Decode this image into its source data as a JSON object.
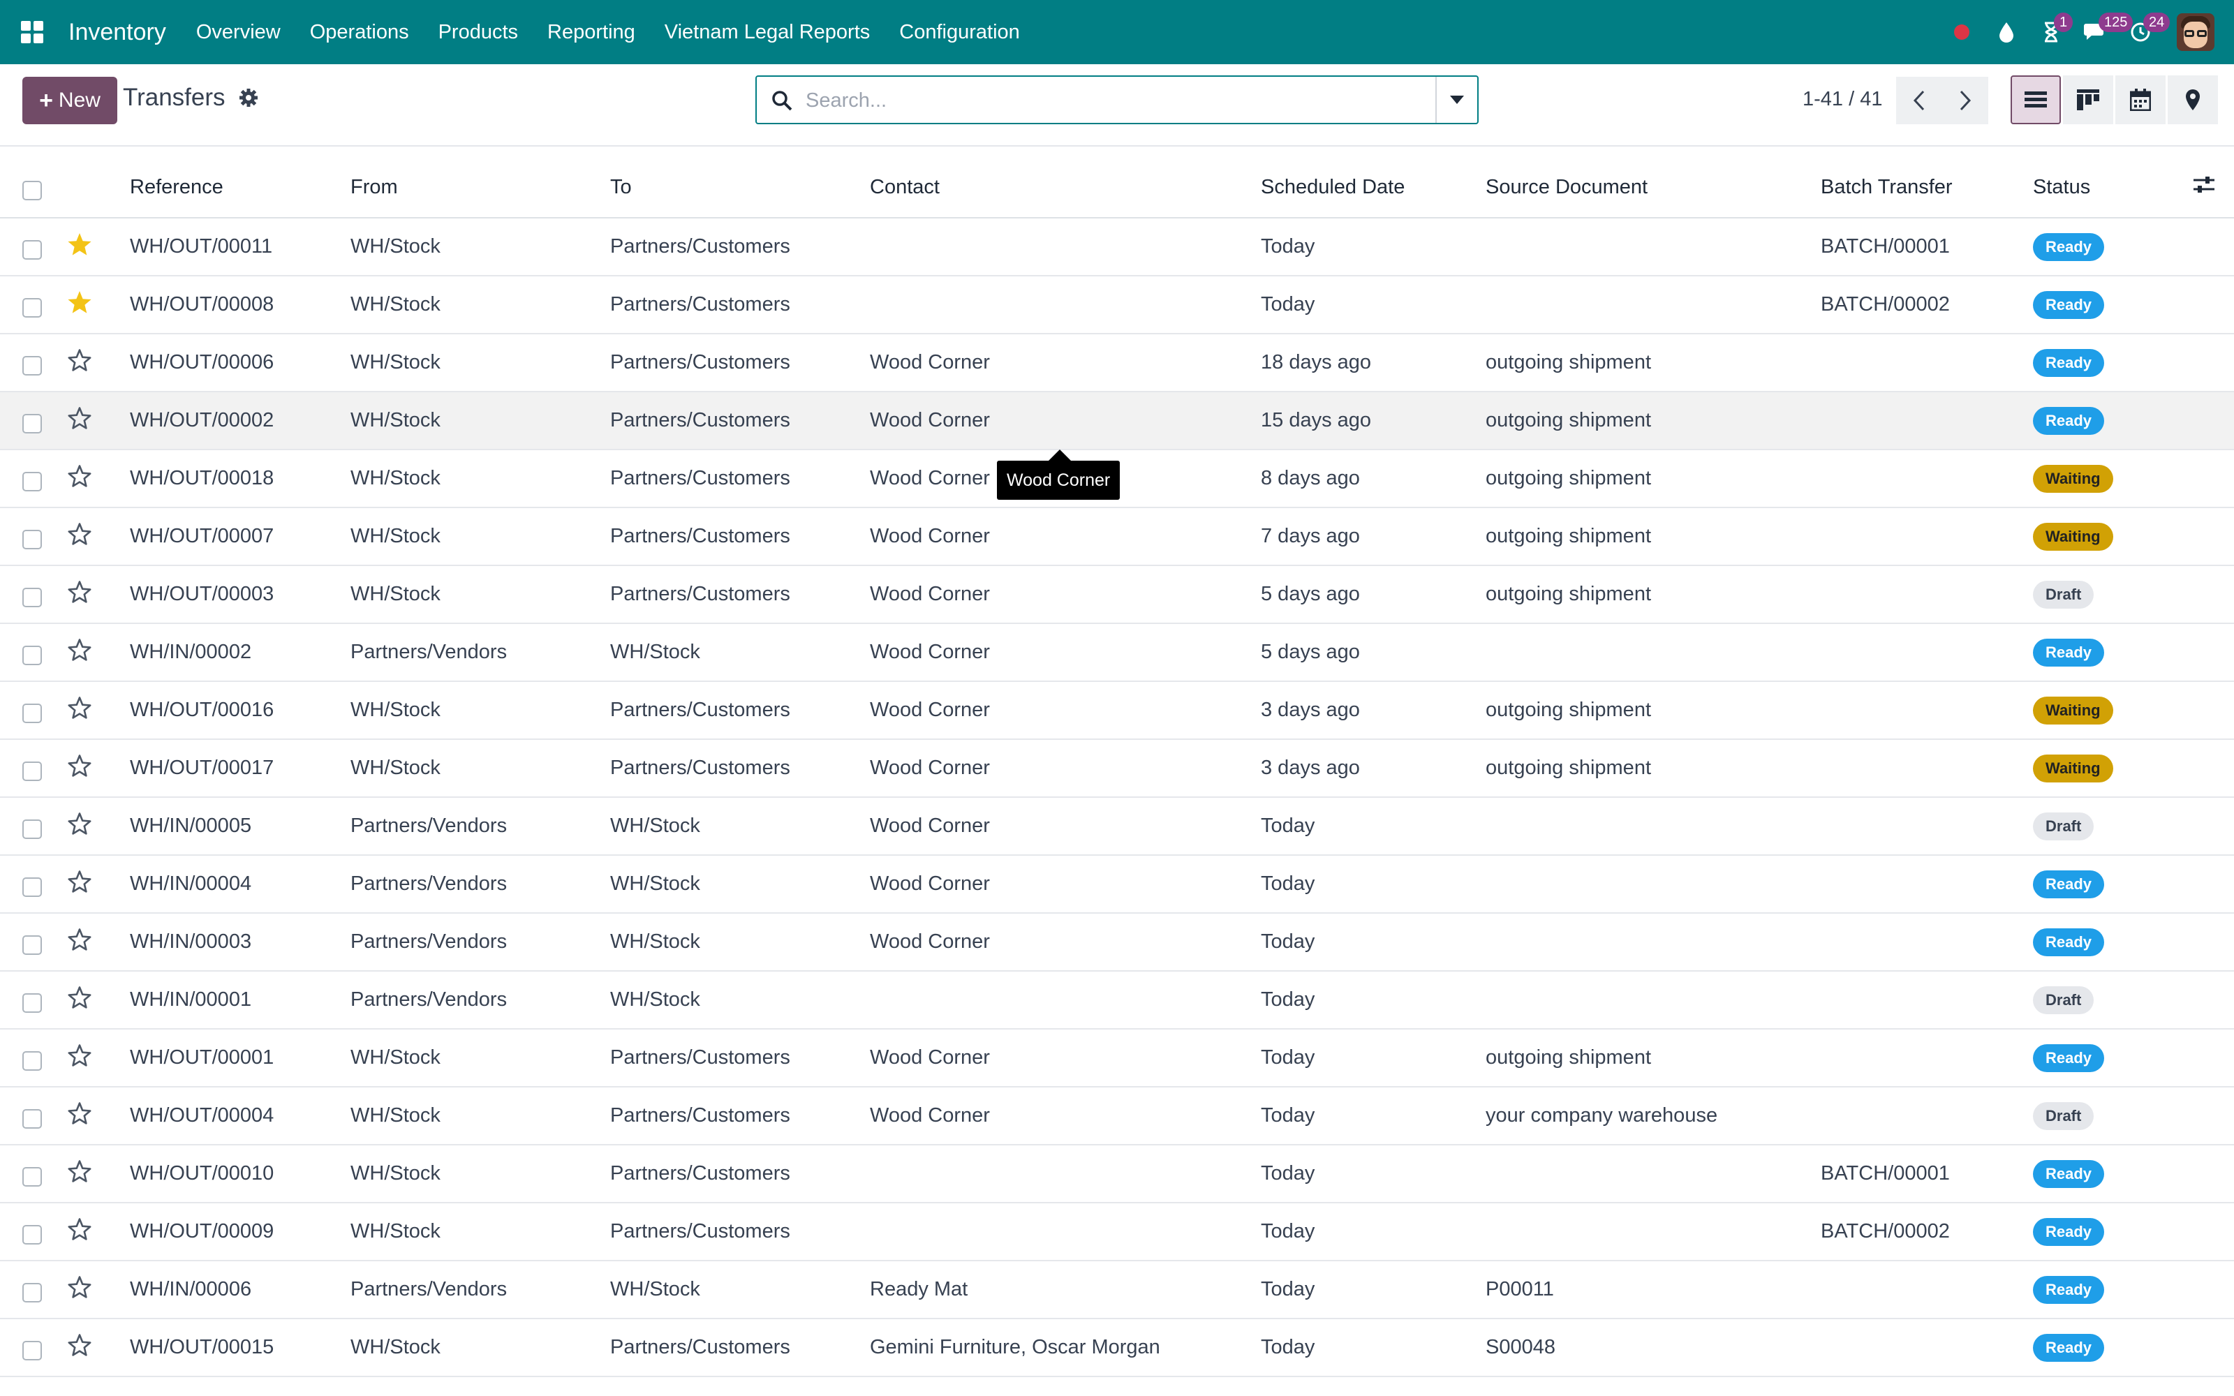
{
  "navbar": {
    "app_name": "Inventory",
    "menu": [
      "Overview",
      "Operations",
      "Products",
      "Reporting",
      "Vietnam Legal Reports",
      "Configuration"
    ],
    "activity_count": "1",
    "messages_count": "125",
    "clock_count": "24"
  },
  "control_panel": {
    "new_label": "New",
    "title": "Transfers",
    "search_placeholder": "Search...",
    "pager": "1-41 / 41"
  },
  "table": {
    "columns": [
      "Reference",
      "From",
      "To",
      "Contact",
      "Scheduled Date",
      "Source Document",
      "Batch Transfer",
      "Status"
    ],
    "rows": [
      {
        "starred": true,
        "reference": "WH/OUT/00011",
        "from": "WH/Stock",
        "to": "Partners/Customers",
        "contact": "",
        "date": "Today",
        "date_kind": "today",
        "source": "",
        "batch": "BATCH/00001",
        "status": "Ready"
      },
      {
        "starred": true,
        "reference": "WH/OUT/00008",
        "from": "WH/Stock",
        "to": "Partners/Customers",
        "contact": "",
        "date": "Today",
        "date_kind": "today",
        "source": "",
        "batch": "BATCH/00002",
        "status": "Ready"
      },
      {
        "starred": false,
        "reference": "WH/OUT/00006",
        "from": "WH/Stock",
        "to": "Partners/Customers",
        "contact": "Wood Corner",
        "date": "18 days ago",
        "date_kind": "late",
        "source": "outgoing shipment",
        "batch": "",
        "status": "Ready"
      },
      {
        "starred": false,
        "reference": "WH/OUT/00002",
        "from": "WH/Stock",
        "to": "Partners/Customers",
        "contact": "Wood Corner",
        "date": "15 days ago",
        "date_kind": "late",
        "source": "outgoing shipment",
        "batch": "",
        "status": "Ready",
        "hover": true
      },
      {
        "starred": false,
        "reference": "WH/OUT/00018",
        "from": "WH/Stock",
        "to": "Partners/Customers",
        "contact": "Wood Corner",
        "date": "8 days ago",
        "date_kind": "late",
        "source": "outgoing shipment",
        "batch": "",
        "status": "Waiting"
      },
      {
        "starred": false,
        "reference": "WH/OUT/00007",
        "from": "WH/Stock",
        "to": "Partners/Customers",
        "contact": "Wood Corner",
        "date": "7 days ago",
        "date_kind": "late",
        "source": "outgoing shipment",
        "batch": "",
        "status": "Waiting"
      },
      {
        "starred": false,
        "reference": "WH/OUT/00003",
        "from": "WH/Stock",
        "to": "Partners/Customers",
        "contact": "Wood Corner",
        "date": "5 days ago",
        "date_kind": "late",
        "source": "outgoing shipment",
        "batch": "",
        "status": "Draft"
      },
      {
        "starred": false,
        "reference": "WH/IN/00002",
        "from": "Partners/Vendors",
        "to": "WH/Stock",
        "contact": "Wood Corner",
        "date": "5 days ago",
        "date_kind": "late",
        "source": "",
        "batch": "",
        "status": "Ready"
      },
      {
        "starred": false,
        "reference": "WH/OUT/00016",
        "from": "WH/Stock",
        "to": "Partners/Customers",
        "contact": "Wood Corner",
        "date": "3 days ago",
        "date_kind": "late",
        "source": "outgoing shipment",
        "batch": "",
        "status": "Waiting"
      },
      {
        "starred": false,
        "reference": "WH/OUT/00017",
        "from": "WH/Stock",
        "to": "Partners/Customers",
        "contact": "Wood Corner",
        "date": "3 days ago",
        "date_kind": "late",
        "source": "outgoing shipment",
        "batch": "",
        "status": "Waiting"
      },
      {
        "starred": false,
        "reference": "WH/IN/00005",
        "from": "Partners/Vendors",
        "to": "WH/Stock",
        "contact": "Wood Corner",
        "date": "Today",
        "date_kind": "today",
        "source": "",
        "batch": "",
        "status": "Draft"
      },
      {
        "starred": false,
        "reference": "WH/IN/00004",
        "from": "Partners/Vendors",
        "to": "WH/Stock",
        "contact": "Wood Corner",
        "date": "Today",
        "date_kind": "today",
        "source": "",
        "batch": "",
        "status": "Ready"
      },
      {
        "starred": false,
        "reference": "WH/IN/00003",
        "from": "Partners/Vendors",
        "to": "WH/Stock",
        "contact": "Wood Corner",
        "date": "Today",
        "date_kind": "today",
        "source": "",
        "batch": "",
        "status": "Ready"
      },
      {
        "starred": false,
        "reference": "WH/IN/00001",
        "from": "Partners/Vendors",
        "to": "WH/Stock",
        "contact": "",
        "date": "Today",
        "date_kind": "today",
        "source": "",
        "batch": "",
        "status": "Draft"
      },
      {
        "starred": false,
        "reference": "WH/OUT/00001",
        "from": "WH/Stock",
        "to": "Partners/Customers",
        "contact": "Wood Corner",
        "date": "Today",
        "date_kind": "today",
        "source": "outgoing shipment",
        "batch": "",
        "status": "Ready"
      },
      {
        "starred": false,
        "reference": "WH/OUT/00004",
        "from": "WH/Stock",
        "to": "Partners/Customers",
        "contact": "Wood Corner",
        "date": "Today",
        "date_kind": "today",
        "source": "your company warehouse",
        "batch": "",
        "status": "Draft"
      },
      {
        "starred": false,
        "reference": "WH/OUT/00010",
        "from": "WH/Stock",
        "to": "Partners/Customers",
        "contact": "",
        "date": "Today",
        "date_kind": "today",
        "source": "",
        "batch": "BATCH/00001",
        "status": "Ready"
      },
      {
        "starred": false,
        "reference": "WH/OUT/00009",
        "from": "WH/Stock",
        "to": "Partners/Customers",
        "contact": "",
        "date": "Today",
        "date_kind": "today",
        "source": "",
        "batch": "BATCH/00002",
        "status": "Ready"
      },
      {
        "starred": false,
        "reference": "WH/IN/00006",
        "from": "Partners/Vendors",
        "to": "WH/Stock",
        "contact": "Ready Mat",
        "date": "Today",
        "date_kind": "today",
        "source": "P00011",
        "batch": "",
        "status": "Ready"
      },
      {
        "starred": false,
        "reference": "WH/OUT/00015",
        "from": "WH/Stock",
        "to": "Partners/Customers",
        "contact": "Gemini Furniture, Oscar Morgan",
        "date": "Today",
        "date_kind": "today",
        "source": "S00048",
        "batch": "",
        "status": "Ready"
      }
    ]
  },
  "tooltip": {
    "text": "Wood Corner"
  },
  "colors": {
    "navbar": "#017e84",
    "primary": "#714b67",
    "ready": "#1f9ee8",
    "waiting": "#d1a105",
    "late": "#dc3545",
    "today": "#d39e00",
    "star": "#f3c316"
  }
}
